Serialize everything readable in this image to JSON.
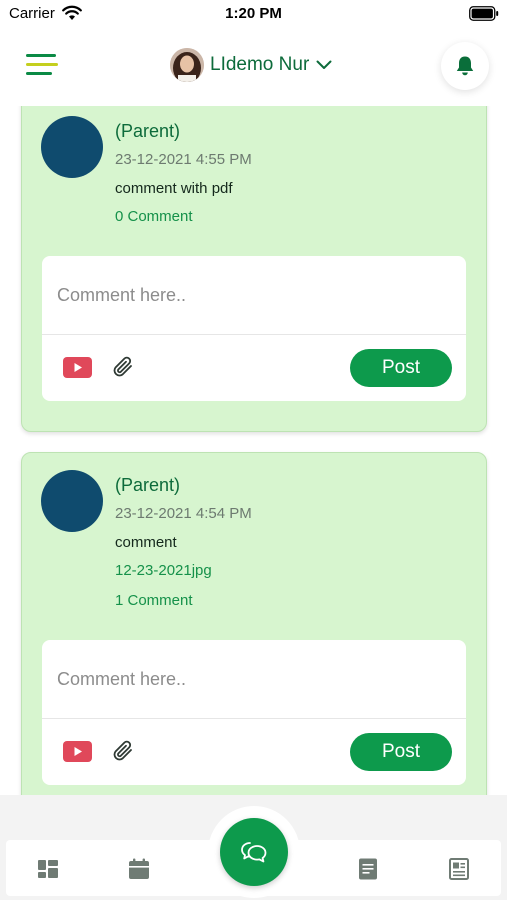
{
  "status_bar": {
    "carrier": "Carrier",
    "time": "1:20 PM"
  },
  "header": {
    "profile_name": "LIdemo Nur"
  },
  "posts": [
    {
      "role": "(Parent)",
      "date": "23-12-2021 4:55 PM",
      "body": "comment with pdf",
      "attachment": "",
      "comments": "0 Comment",
      "comment_placeholder": "Comment here..",
      "post_label": "Post"
    },
    {
      "role": "(Parent)",
      "date": "23-12-2021 4:54 PM",
      "body": "comment",
      "attachment": "12-23-2021jpg",
      "comments": "1 Comment",
      "comment_placeholder": "Comment here..",
      "post_label": "Post"
    }
  ],
  "bottom_nav": {
    "items": [
      {
        "icon": "dashboard-icon"
      },
      {
        "icon": "calendar-icon"
      },
      {
        "icon": "chat-icon"
      },
      {
        "icon": "report-icon"
      },
      {
        "icon": "newspaper-icon"
      }
    ]
  },
  "colors": {
    "brand_green": "#0d9a4c",
    "card_background": "#d7f5cf",
    "accent_yellow": "#c4cf1e",
    "avatar_blue": "#0f4b6e"
  }
}
